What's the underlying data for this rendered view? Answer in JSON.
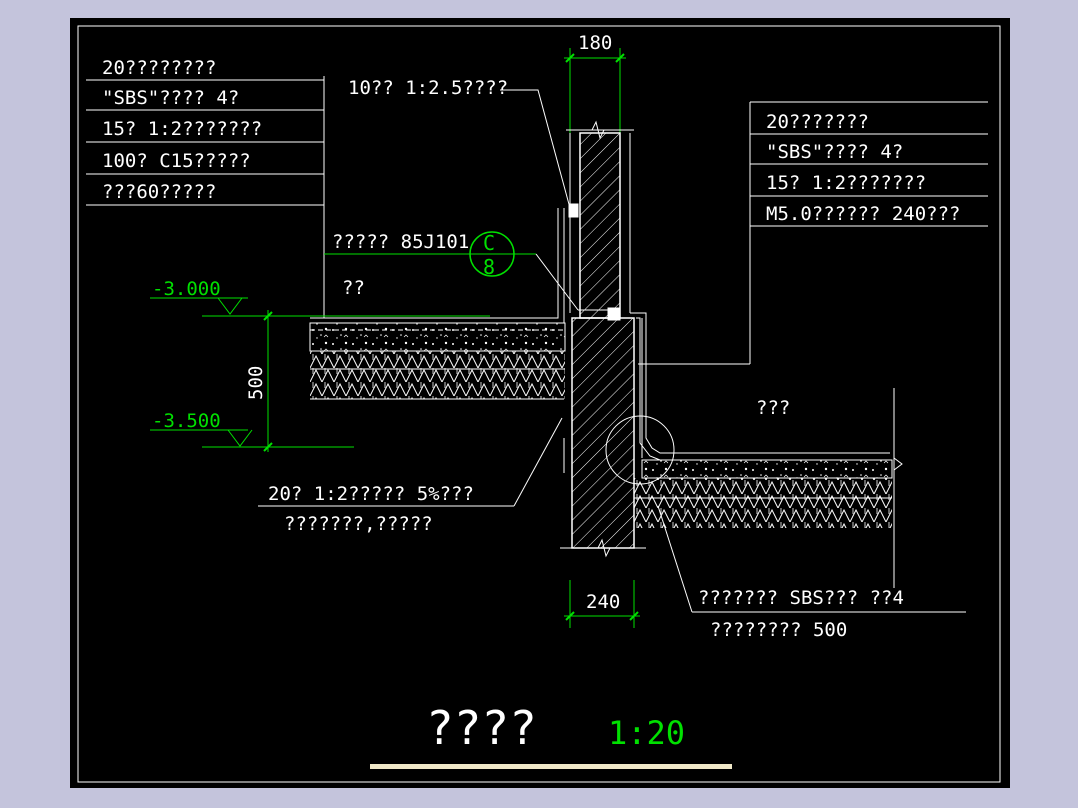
{
  "drawing": {
    "title": "????",
    "scale": "1:20",
    "colors": {
      "background": "#000000",
      "linework": "#ffffff",
      "dimension": "#00e000",
      "frame_surround": "#c4c4dc"
    }
  },
  "dimensions": {
    "top_wall": "180",
    "bottom_wall": "240",
    "height_diff": "500"
  },
  "elevations": {
    "upper": "-3.000",
    "lower": "-3.500"
  },
  "left_layers": [
    "20????????",
    "\"SBS\"????  4?",
    "15? 1:2???????",
    "100? C15?????",
    "???60?????"
  ],
  "right_layers": [
    "20???????",
    "\"SBS\"????  4?",
    "15? 1:2???????",
    "M5.0??????  240???"
  ],
  "labels": {
    "top_note": "10?? 1:2.5????",
    "detail_ref": "?????  85J101",
    "detail_circle_top": "C",
    "detail_circle_bottom": "8",
    "upper_room": "??",
    "lower_room": "???",
    "bottom_left_line1": "20? 1:2?????  5%???",
    "bottom_left_line2": "???????,?????",
    "bottom_right_line1": "???????   SBS???  ??4",
    "bottom_right_line2": "????????   500"
  }
}
